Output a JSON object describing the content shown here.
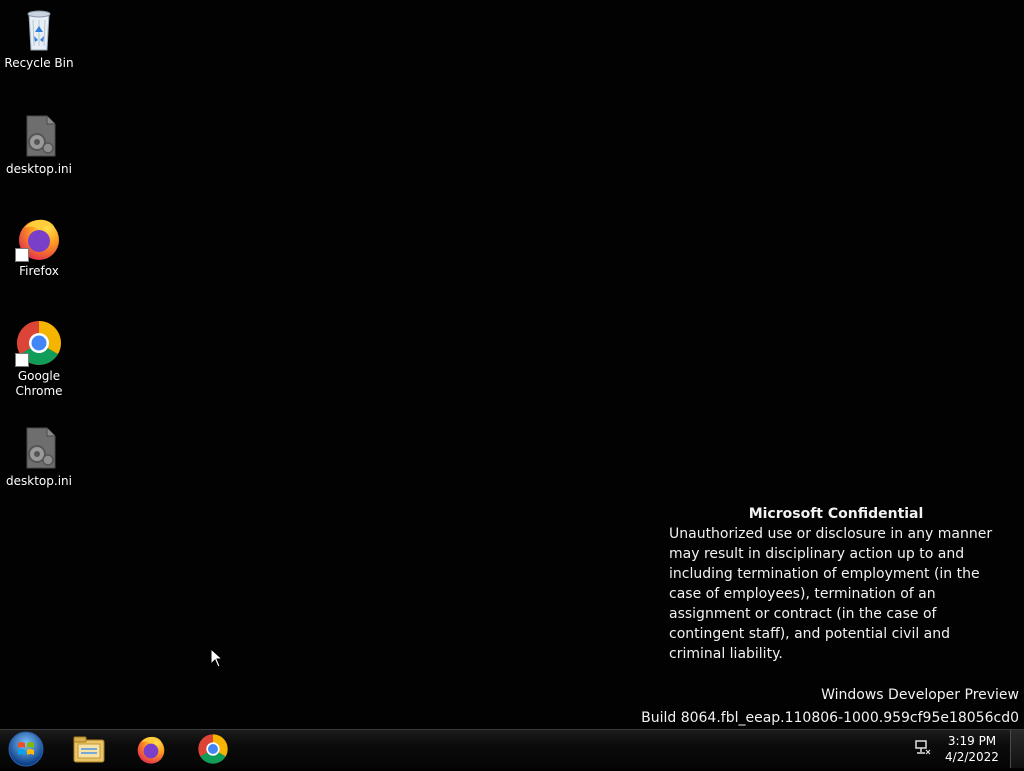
{
  "desktop": {
    "icons": [
      {
        "label": "Recycle Bin",
        "icon": "recycle-bin-icon"
      },
      {
        "label": "desktop.ini",
        "icon": "settings-file-icon"
      },
      {
        "label": "Firefox",
        "icon": "firefox-icon"
      },
      {
        "label": "Google\nChrome",
        "icon": "chrome-icon"
      },
      {
        "label": "desktop.ini",
        "icon": "settings-file-icon"
      }
    ]
  },
  "watermark": {
    "title": "Microsoft Confidential",
    "body": "Unauthorized use or disclosure in any manner may result in disciplinary action up to and including termination of employment (in the case of employees), termination of an assignment or contract (in the case of contingent staff), and potential civil and criminal liability."
  },
  "build": {
    "edition": "Windows Developer Preview",
    "build_string": "Build 8064.fbl_eeap.110806-1000.959cf95e18056cd0"
  },
  "taskbar": {
    "pinned": [
      {
        "name": "Windows Explorer",
        "icon": "file-explorer-icon"
      },
      {
        "name": "Firefox",
        "icon": "firefox-icon"
      },
      {
        "name": "Google Chrome",
        "icon": "chrome-icon"
      }
    ],
    "clock": {
      "time": "3:19 PM",
      "date": "4/2/2022"
    }
  },
  "colors": {
    "desktop_bg": "#020202",
    "taskbar_bg": "#0b0b0b",
    "text": "#ffffff"
  }
}
